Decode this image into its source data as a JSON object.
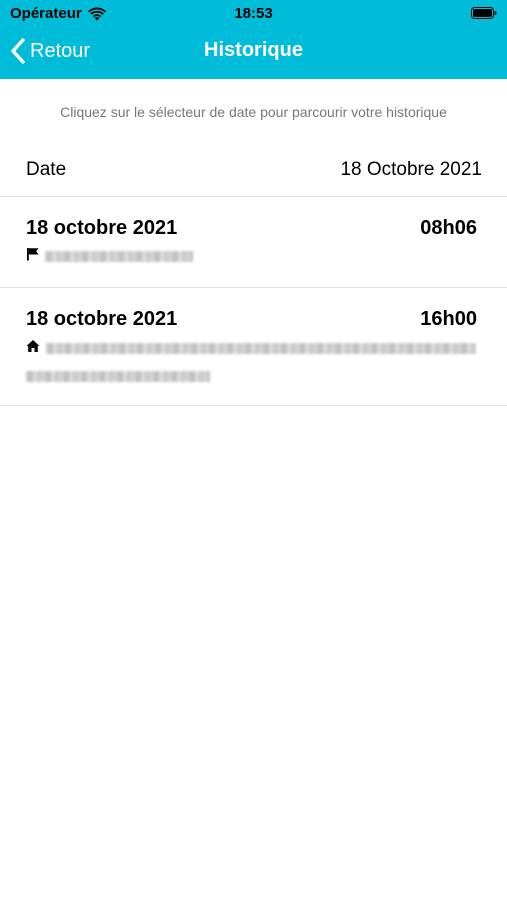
{
  "status_bar": {
    "carrier": "Opérateur",
    "time": "18:53",
    "icons": [
      "wifi-icon",
      "battery-icon"
    ]
  },
  "nav": {
    "back_label": "Retour",
    "back_icon": "chevron-left-icon",
    "title": "Historique",
    "background_color": "#00bcd9"
  },
  "hint": "Cliquez sur le sélecteur de date pour parcourir votre historique",
  "date_picker": {
    "label": "Date",
    "value": "18 Octobre 2021"
  },
  "entries": [
    {
      "date": "18 octobre 2021",
      "time": "08h06",
      "icon": "flag-icon"
    },
    {
      "date": "18 octobre 2021",
      "time": "16h00",
      "icon": "home-icon"
    }
  ]
}
